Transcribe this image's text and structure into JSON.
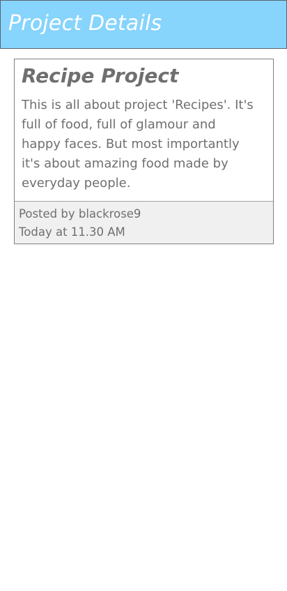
{
  "header": {
    "title": "Project Details"
  },
  "project": {
    "title": "Recipe Project",
    "description": "This is all about project 'Recipes'. It's full of food, full of glamour and happy faces. But most importantly it's about amazing food made by everyday people.",
    "posted_by": "Posted by blackrose9",
    "posted_at": "Today at 11.30 AM"
  },
  "colors": {
    "header_background": "#87d4fc",
    "header_text": "#ffffff",
    "body_text": "#6f6f6f",
    "card_border": "#808080",
    "footer_background": "#f0f0f0"
  }
}
